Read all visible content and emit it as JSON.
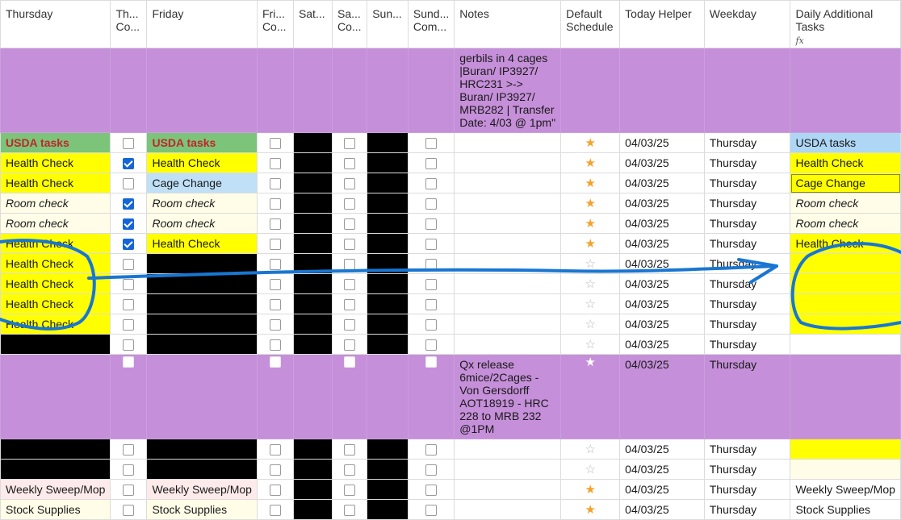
{
  "headers": {
    "thursday": "Thursday",
    "thursday_complete": "Th... Co...",
    "friday": "Friday",
    "friday_complete": "Fri... Co...",
    "saturday": "Sat...",
    "saturday_complete": "Sa... Co...",
    "sunday": "Sun...",
    "sunday_complete": "Sund... Com...",
    "notes": "Notes",
    "default_schedule": "Default Schedule",
    "today_helper": "Today Helper",
    "weekday": "Weekday",
    "daily_additional_tasks": "Daily Additional Tasks",
    "formula_icon": "fx"
  },
  "rows": [
    {
      "kind": "purple",
      "notes": "gerbils in 4 cages |Buran/ IP3927/ HRC231 >-> Buran/ IP3927/ MRB282 | Transfer Date: 4/03 @ 1pm\"",
      "date": "",
      "weekday": "",
      "daily": "",
      "star": "none",
      "thu": "",
      "fri": ""
    },
    {
      "kind": "std",
      "thu": "USDA tasks",
      "thu_style": "usda",
      "thu_done": false,
      "fri": "USDA tasks",
      "fri_style": "usda",
      "fri_done": false,
      "star": "on",
      "date": "04/03/25",
      "weekday": "Thursday",
      "daily": "USDA tasks",
      "daily_style": "usda-r"
    },
    {
      "kind": "std",
      "thu": "Health Check",
      "thu_style": "yel",
      "thu_done": true,
      "fri": "Health Check",
      "fri_style": "yel",
      "fri_done": false,
      "star": "on",
      "date": "04/03/25",
      "weekday": "Thursday",
      "daily": "Health Check",
      "daily_style": "yel"
    },
    {
      "kind": "std",
      "thu": "Health Check",
      "thu_style": "yel",
      "thu_done": false,
      "fri": "Cage Change",
      "fri_style": "blue",
      "fri_done": false,
      "star": "on",
      "date": "04/03/25",
      "weekday": "Thursday",
      "daily": "Cage Change",
      "daily_style": "cage-r"
    },
    {
      "kind": "std",
      "thu": "Room check",
      "thu_style": "cream",
      "thu_done": true,
      "fri": "Room check",
      "fri_style": "cream",
      "fri_done": false,
      "star": "on",
      "date": "04/03/25",
      "weekday": "Thursday",
      "daily": "Room check",
      "daily_style": "cream"
    },
    {
      "kind": "std",
      "thu": "Room check",
      "thu_style": "cream",
      "thu_done": true,
      "fri": "Room check",
      "fri_style": "cream",
      "fri_done": false,
      "star": "on",
      "date": "04/03/25",
      "weekday": "Thursday",
      "daily": "Room check",
      "daily_style": "cream"
    },
    {
      "kind": "std",
      "thu": "Health Check",
      "thu_style": "yel",
      "thu_done": true,
      "fri": "Health Check",
      "fri_style": "yel",
      "fri_done": false,
      "star": "on",
      "date": "04/03/25",
      "weekday": "Thursday",
      "daily": "Health Check",
      "daily_style": "yel"
    },
    {
      "kind": "std",
      "thu": "Health Check",
      "thu_style": "yel",
      "thu_done": false,
      "fri": "",
      "fri_style": "blk",
      "fri_done": false,
      "star": "off",
      "date": "04/03/25",
      "weekday": "Thursday",
      "daily": "",
      "daily_style": "yel"
    },
    {
      "kind": "std",
      "thu": "Health Check",
      "thu_style": "yel",
      "thu_done": false,
      "fri": "",
      "fri_style": "blk",
      "fri_done": false,
      "star": "off",
      "date": "04/03/25",
      "weekday": "Thursday",
      "daily": "",
      "daily_style": "yel"
    },
    {
      "kind": "std",
      "thu": "Health Check",
      "thu_style": "yel",
      "thu_done": false,
      "fri": "",
      "fri_style": "blk",
      "fri_done": false,
      "star": "off",
      "date": "04/03/25",
      "weekday": "Thursday",
      "daily": "",
      "daily_style": "yel"
    },
    {
      "kind": "std",
      "thu": "Health Check",
      "thu_style": "yel",
      "thu_done": false,
      "fri": "",
      "fri_style": "blk",
      "fri_done": false,
      "star": "off",
      "date": "04/03/25",
      "weekday": "Thursday",
      "daily": "",
      "daily_style": "yel"
    },
    {
      "kind": "std",
      "thu": "",
      "thu_style": "blk",
      "thu_done": false,
      "fri": "",
      "fri_style": "blk",
      "fri_done": false,
      "star": "off",
      "date": "04/03/25",
      "weekday": "Thursday",
      "daily": "",
      "daily_style": ""
    },
    {
      "kind": "purple2",
      "notes": "Qx release 6mice/2Cages - Von Gersdorff AOT18919 - HRC 228 to MRB 232 @1PM",
      "star": "white",
      "date": "04/03/25",
      "weekday": "Thursday",
      "daily": "",
      "thu": "",
      "fri": ""
    },
    {
      "kind": "std",
      "thu": "",
      "thu_style": "blk",
      "thu_done": false,
      "fri": "",
      "fri_style": "blk",
      "fri_done": false,
      "star": "off",
      "date": "04/03/25",
      "weekday": "Thursday",
      "daily": "",
      "daily_style": "yel"
    },
    {
      "kind": "std",
      "thu": "",
      "thu_style": "blk",
      "thu_done": false,
      "fri": "",
      "fri_style": "blk",
      "fri_done": false,
      "star": "off",
      "date": "04/03/25",
      "weekday": "Thursday",
      "daily": "",
      "daily_style": "cream-n"
    },
    {
      "kind": "std",
      "thu": "Weekly Sweep/Mop",
      "thu_style": "pink",
      "thu_done": false,
      "fri": "Weekly Sweep/Mop",
      "fri_style": "pink",
      "fri_done": false,
      "star": "on",
      "date": "04/03/25",
      "weekday": "Thursday",
      "daily": "Weekly Sweep/Mop",
      "daily_style": ""
    },
    {
      "kind": "std",
      "thu": "Stock Supplies",
      "thu_style": "cream-n",
      "thu_done": false,
      "fri": "Stock Supplies",
      "fri_style": "cream-n",
      "fri_done": false,
      "star": "on",
      "date": "04/03/25",
      "weekday": "Thursday",
      "daily": "Stock Supplies",
      "daily_style": ""
    }
  ],
  "annotation": {
    "color": "#1976d2",
    "shapes": [
      "circle-left",
      "arrow-right",
      "circle-right"
    ]
  }
}
